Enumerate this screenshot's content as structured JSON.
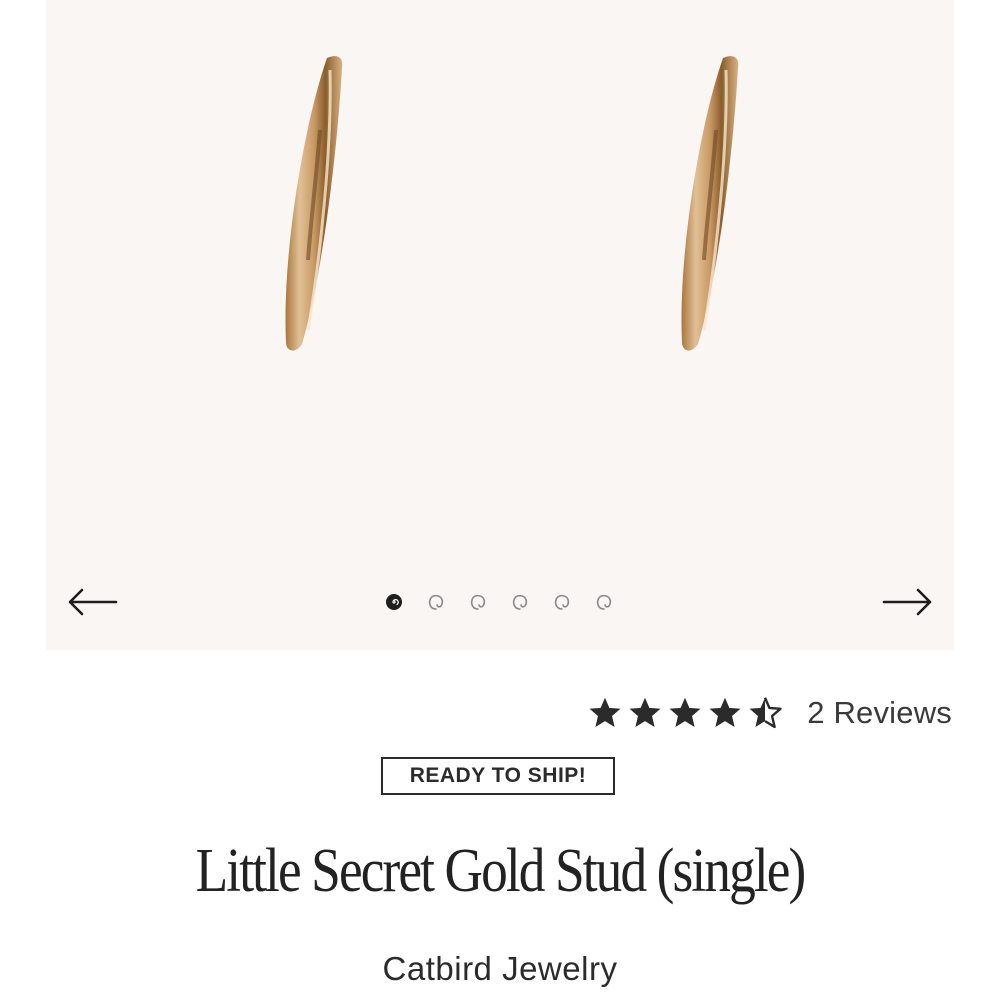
{
  "gallery": {
    "image_alt": "Little Secret Gold Stud (single)",
    "prev_icon": "arrow-left-icon",
    "next_icon": "arrow-right-icon",
    "dot_count": 6,
    "active_dot_index": 0
  },
  "rating": {
    "value": 4.5,
    "max": 5,
    "reviews_label": "2 Reviews"
  },
  "badge": {
    "label": "READY TO SHIP!"
  },
  "product": {
    "title": "Little Secret Gold Stud (single)",
    "brand": "Catbird Jewelry"
  },
  "colors": {
    "gallery_bg": "#faf6f3",
    "gold": "#c99a66",
    "text": "#2b2b2b"
  }
}
